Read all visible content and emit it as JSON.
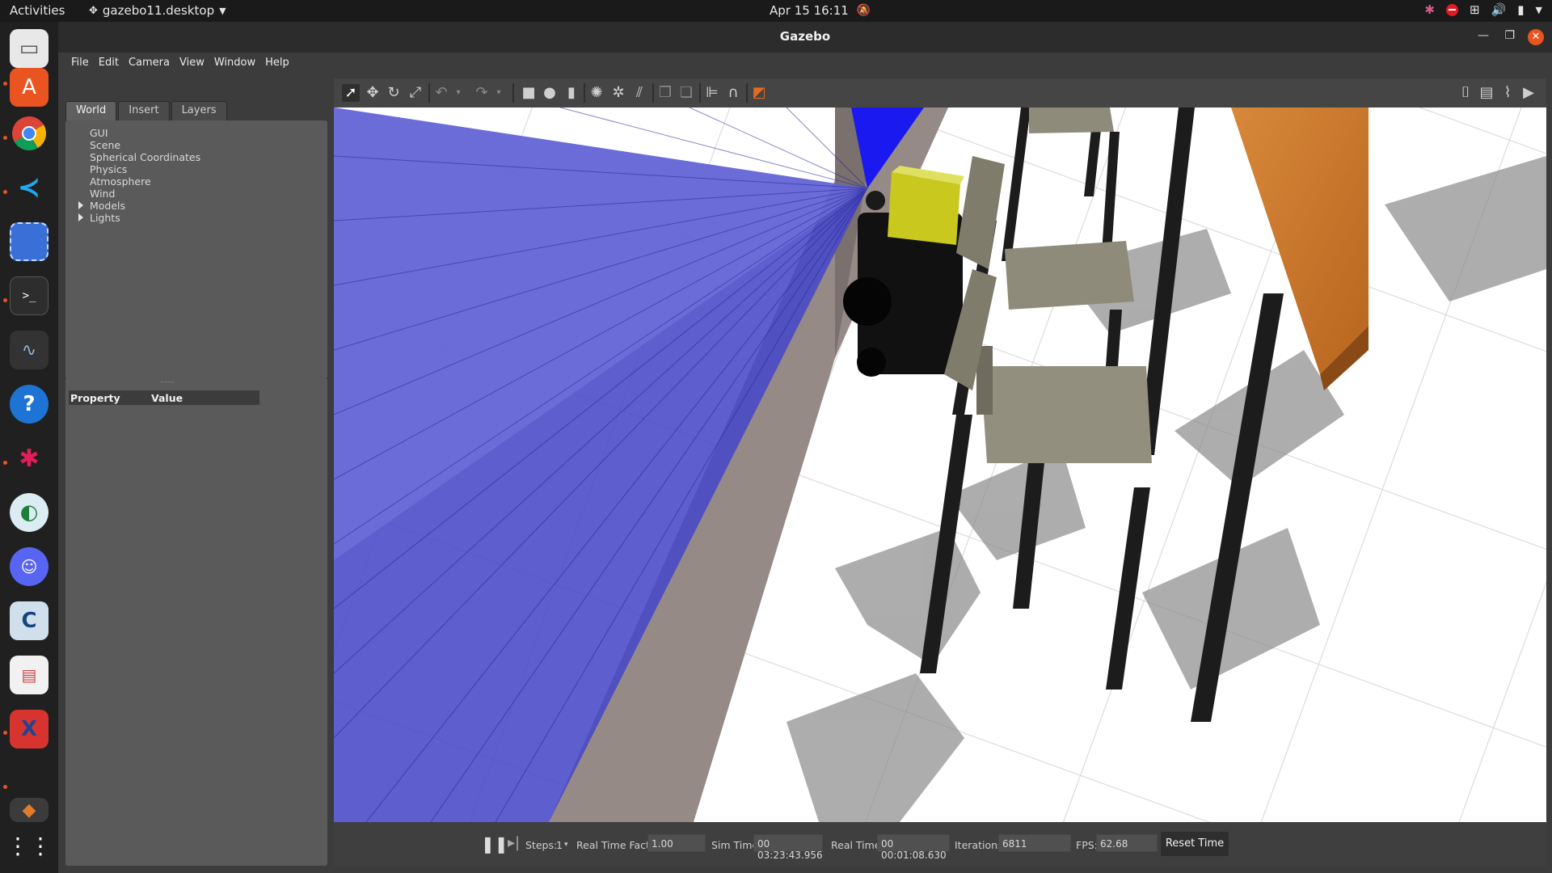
{
  "topbar": {
    "activities": "Activities",
    "app_name": "gazebo11.desktop",
    "clock": "Apr 15  16:11"
  },
  "window": {
    "title": "Gazebo"
  },
  "menus": [
    "File",
    "Edit",
    "Camera",
    "View",
    "Window",
    "Help"
  ],
  "left_panel": {
    "tabs": [
      "World",
      "Insert",
      "Layers"
    ],
    "active_tab": "World",
    "tree": [
      {
        "label": "GUI",
        "expandable": false
      },
      {
        "label": "Scene",
        "expandable": false
      },
      {
        "label": "Spherical Coordinates",
        "expandable": false
      },
      {
        "label": "Physics",
        "expandable": false
      },
      {
        "label": "Atmosphere",
        "expandable": false
      },
      {
        "label": "Wind",
        "expandable": false
      },
      {
        "label": "Models",
        "expandable": true
      },
      {
        "label": "Lights",
        "expandable": true
      }
    ],
    "property_header": {
      "property": "Property",
      "value": "Value"
    }
  },
  "bottom_bar": {
    "steps_label": "Steps:",
    "steps_value": "1",
    "rtf_label": "Real Time Factor:",
    "rtf_value": "1.00",
    "sim_time_label": "Sim Time:",
    "sim_time_value": "00 03:23:43.956",
    "real_time_label": "Real Time:",
    "real_time_value": "00 00:01:08.630",
    "iterations_label": "Iterations:",
    "iterations_value": "6811",
    "fps_label": "FPS:",
    "fps_value": "62.68",
    "reset_label": "Reset Time"
  },
  "colors": {
    "accent": "#e95420",
    "laser_blue": "#2a2aff",
    "robot_yellow": "#c8c81e",
    "table_wood": "#c8762e"
  }
}
